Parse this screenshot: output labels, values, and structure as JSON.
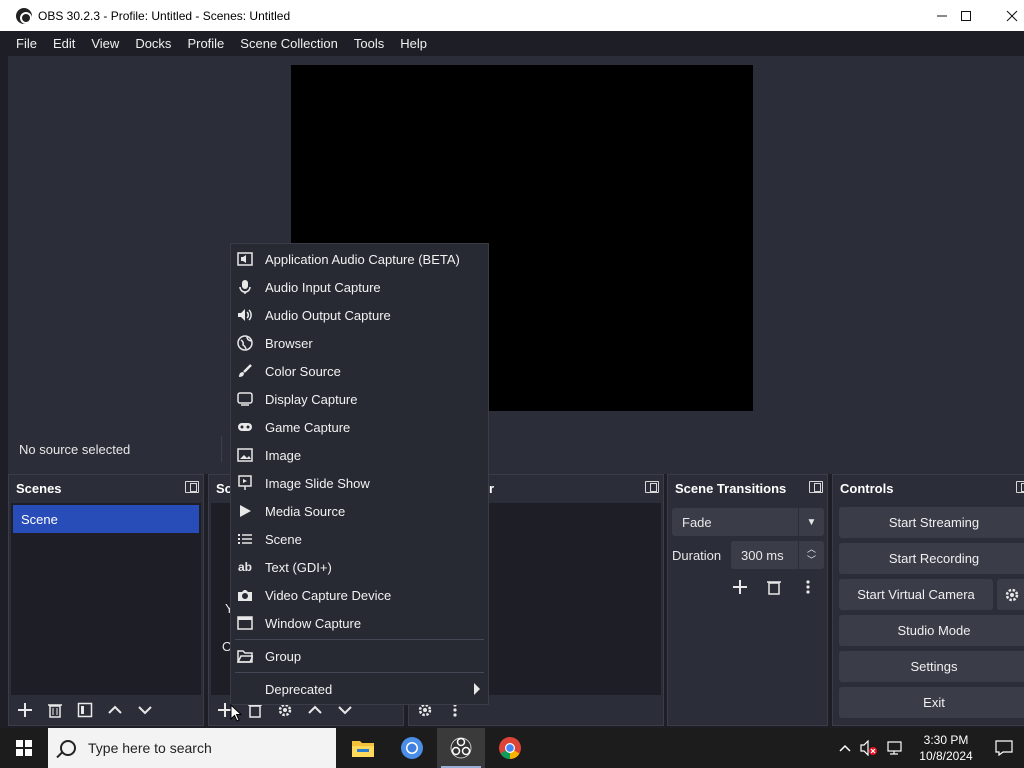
{
  "window": {
    "title": "OBS 30.2.3 - Profile: Untitled - Scenes: Untitled",
    "controls": [
      "—",
      "☐",
      "✕"
    ]
  },
  "menubar": [
    "File",
    "Edit",
    "View",
    "Docks",
    "Profile",
    "Scene Collection",
    "Tools",
    "Help"
  ],
  "source_bar": {
    "status": "No source selected"
  },
  "scenes_dock": {
    "title": "Scenes",
    "items": [
      "Scene"
    ],
    "selected": "Scene"
  },
  "sources_dock": {
    "title_partial": "So",
    "fragments": [
      "Y",
      "O"
    ]
  },
  "mixer_dock": {
    "title_partial": "r"
  },
  "transitions_dock": {
    "title": "Scene Transitions",
    "transition": "Fade",
    "duration_label": "Duration",
    "duration_value": "300 ms"
  },
  "controls_dock": {
    "title": "Controls",
    "buttons": [
      "Start Streaming",
      "Start Recording",
      "Start Virtual Camera",
      "Studio Mode",
      "Settings",
      "Exit"
    ]
  },
  "context_menu": {
    "items": [
      {
        "label": "Application Audio Capture (BETA)",
        "icon": "app-audio-icon"
      },
      {
        "label": "Audio Input Capture",
        "icon": "microphone-icon"
      },
      {
        "label": "Audio Output Capture",
        "icon": "speaker-icon"
      },
      {
        "label": "Browser",
        "icon": "globe-icon"
      },
      {
        "label": "Color Source",
        "icon": "brush-icon"
      },
      {
        "label": "Display Capture",
        "icon": "monitor-icon"
      },
      {
        "label": "Game Capture",
        "icon": "gamepad-icon"
      },
      {
        "label": "Image",
        "icon": "image-icon"
      },
      {
        "label": "Image Slide Show",
        "icon": "slideshow-icon"
      },
      {
        "label": "Media Source",
        "icon": "play-icon"
      },
      {
        "label": "Scene",
        "icon": "list-icon"
      },
      {
        "label": "Text (GDI+)",
        "icon": "text-icon"
      },
      {
        "label": "Video Capture Device",
        "icon": "camera-icon"
      },
      {
        "label": "Window Capture",
        "icon": "window-icon"
      }
    ],
    "group": {
      "label": "Group",
      "icon": "folder-icon"
    },
    "deprecated": {
      "label": "Deprecated",
      "icon": "submenu-arrow-icon"
    }
  },
  "taskbar": {
    "search_placeholder": "Type here to search",
    "apps": [
      "file-explorer-icon",
      "chrome-icon",
      "obs-icon",
      "chrome-icon"
    ],
    "time": "3:30 PM",
    "date": "10/8/2024"
  }
}
